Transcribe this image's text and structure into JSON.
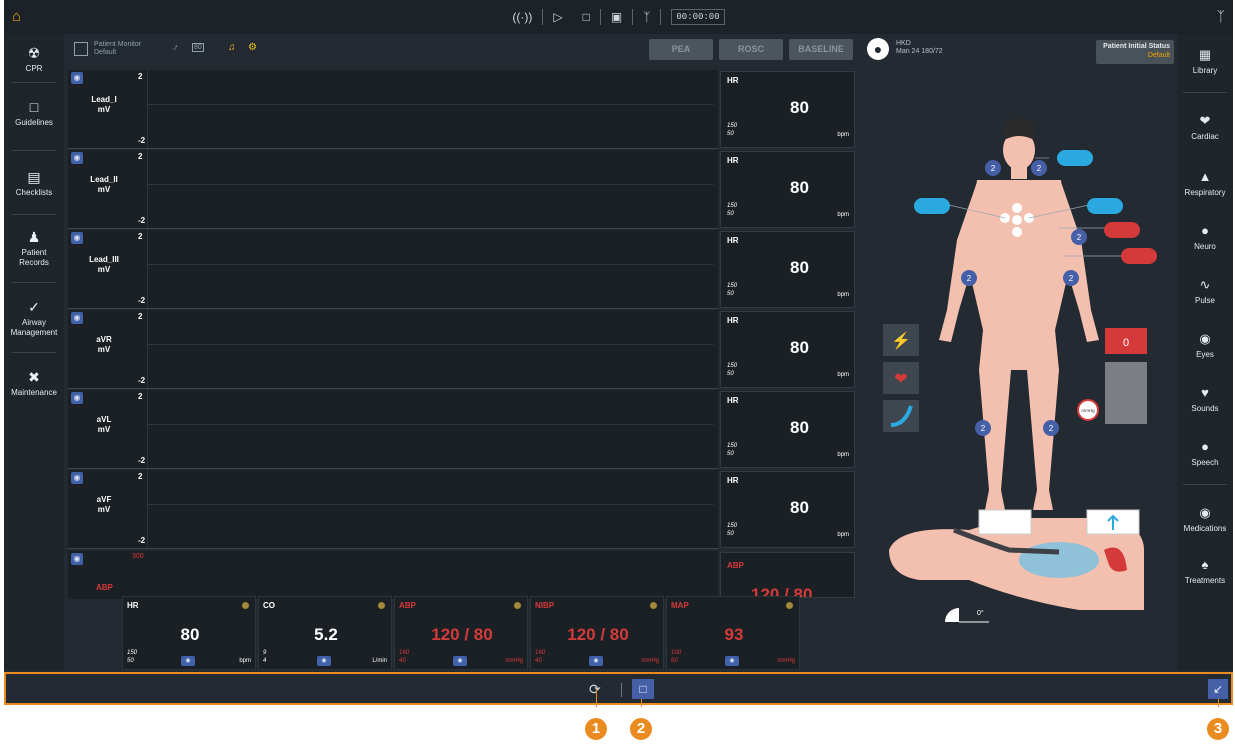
{
  "topbar": {
    "timer": "00:00:00",
    "icons": [
      "home-icon",
      "signal-icon",
      "play-icon",
      "stop-icon",
      "save-icon",
      "bluetooth-icon"
    ]
  },
  "monitor": {
    "layout_title": "Patient Monitor",
    "layout_sub": "Default",
    "states": [
      "PEA",
      "ROSC",
      "BASELINE"
    ],
    "patient_name": "HKD",
    "patient_info": "Man 24 180/72",
    "initial_status_label": "Patient Initial Status",
    "initial_status_value": "Default"
  },
  "left_nav": [
    {
      "label": "CPR",
      "icon": "cpr-icon"
    },
    {
      "label": "Guidelines",
      "icon": "guidelines-icon"
    },
    {
      "label": "Checklists",
      "icon": "checklist-icon"
    },
    {
      "label": "Patient Records",
      "icon": "patient-records-icon"
    },
    {
      "label": "Airway Management",
      "icon": "airway-icon"
    },
    {
      "label": "Maintenance",
      "icon": "maintenance-icon"
    }
  ],
  "right_nav": [
    {
      "label": "Library",
      "icon": "library-icon"
    },
    {
      "label": "Cardiac",
      "icon": "cardiac-icon"
    },
    {
      "label": "Respiratory",
      "icon": "lungs-icon"
    },
    {
      "label": "Neuro",
      "icon": "brain-icon"
    },
    {
      "label": "Pulse",
      "icon": "pulse-icon"
    },
    {
      "label": "Eyes",
      "icon": "eye-icon"
    },
    {
      "label": "Sounds",
      "icon": "stethoscope-icon"
    },
    {
      "label": "Speech",
      "icon": "speech-icon"
    },
    {
      "label": "Medications",
      "icon": "medications-icon"
    },
    {
      "label": "Treatments",
      "icon": "treatments-icon"
    }
  ],
  "waves": [
    {
      "lead": "Lead_I",
      "unit": "mV",
      "max": "2",
      "min": "-2"
    },
    {
      "lead": "Lead_II",
      "unit": "mV",
      "max": "2",
      "min": "-2"
    },
    {
      "lead": "Lead_III",
      "unit": "mV",
      "max": "2",
      "min": "-2"
    },
    {
      "lead": "aVR",
      "unit": "mV",
      "max": "2",
      "min": "-2"
    },
    {
      "lead": "aVL",
      "unit": "mV",
      "max": "2",
      "min": "-2"
    },
    {
      "lead": "aVF",
      "unit": "mV",
      "max": "2",
      "min": "-2"
    }
  ],
  "hr_boxes": [
    {
      "label": "HR",
      "value": "80",
      "hi": "150",
      "lo": "50",
      "unit": "bpm"
    },
    {
      "label": "HR",
      "value": "80",
      "hi": "150",
      "lo": "50",
      "unit": "bpm"
    },
    {
      "label": "HR",
      "value": "80",
      "hi": "150",
      "lo": "50",
      "unit": "bpm"
    },
    {
      "label": "HR",
      "value": "80",
      "hi": "150",
      "lo": "50",
      "unit": "bpm"
    },
    {
      "label": "HR",
      "value": "80",
      "hi": "150",
      "lo": "50",
      "unit": "bpm"
    },
    {
      "label": "HR",
      "value": "80",
      "hi": "150",
      "lo": "50",
      "unit": "bpm"
    }
  ],
  "abp_wave": {
    "lead": "ABP",
    "max": "300"
  },
  "abp_box": {
    "label": "ABP",
    "value": "120 / 80"
  },
  "tiles": [
    {
      "label": "HR",
      "value": "80",
      "hi": "150",
      "lo": "50",
      "unit": "bpm",
      "color": "white"
    },
    {
      "label": "CO",
      "value": "5.2",
      "hi": "9",
      "lo": "4",
      "unit": "L/min",
      "color": "white"
    },
    {
      "label": "ABP",
      "value": "120 / 80",
      "hi": "160",
      "lo": "40",
      "unit": "mmHg",
      "color": "red"
    },
    {
      "label": "NIBP",
      "value": "120 / 80",
      "hi": "160",
      "lo": "40",
      "unit": "mmHg",
      "color": "red"
    },
    {
      "label": "MAP",
      "value": "93",
      "hi": "100",
      "lo": "60",
      "unit": "mmHg",
      "color": "red"
    }
  ],
  "body_view": {
    "counter_value": "0",
    "bp_label": "mmHg",
    "angle_label": "0°",
    "sensor_count": "2"
  },
  "callouts": [
    "1",
    "2",
    "3"
  ],
  "colors": {
    "accent": "#e98b1f",
    "bg": "#232a31",
    "panel": "#1b2025",
    "blue_btn": "#4660a8",
    "alarm_red": "#d53a3a",
    "cyan_sensor": "#2aa8e0"
  }
}
